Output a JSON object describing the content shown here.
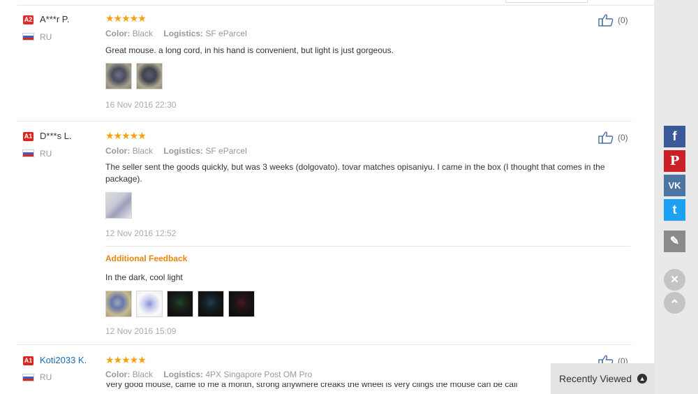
{
  "reviews": [
    {
      "level": "A2",
      "name": "A***r P.",
      "country": "RU",
      "stars": "★★★★★",
      "color_label": "Color:",
      "color_value": "Black",
      "logistics_label": "Logistics:",
      "logistics_value": "SF eParcel",
      "text": "Great mouse. a long cord, in his hand is convenient, but light is just gorgeous.",
      "date": "16 Nov 2016 22:30",
      "likes": "(0)"
    },
    {
      "level": "A1",
      "name": "D***s L.",
      "country": "RU",
      "stars": "★★★★★",
      "color_label": "Color:",
      "color_value": "Black",
      "logistics_label": "Logistics:",
      "logistics_value": "SF eParcel",
      "text": "The seller sent the goods quickly, but was 3 weeks (dolgovato). tovar matches opisaniyu. I came in the box (I thought that comes in the package).",
      "date": "12 Nov 2016 12:52",
      "likes": "(0)",
      "additional_title": "Additional Feedback",
      "additional_text": "In the dark, cool light",
      "additional_date": "12 Nov 2016 15:09"
    },
    {
      "level": "A1",
      "name": "Koti2033 K.",
      "country": "RU",
      "stars": "★★★★★",
      "color_label": "Color:",
      "color_value": "Black",
      "logistics_label": "Logistics:",
      "logistics_value": "4PX Singapore Post OM Pro",
      "text_partial": "Very good mouse, came to me a month, strong anywhere creaks the wheel is very clings the mouse can be call",
      "likes": "(0)"
    }
  ],
  "share_icons": {
    "facebook": "f",
    "pinterest": "P",
    "vk": "VK",
    "twitter": "t",
    "edit": "✎",
    "close": "✕",
    "up": "⌃"
  },
  "colors": {
    "facebook": "#3b5998",
    "pinterest": "#cb2027",
    "vk": "#4c75a3",
    "twitter": "#1da1f2",
    "edit": "#8a8a8a"
  },
  "recently_viewed": "Recently Viewed"
}
